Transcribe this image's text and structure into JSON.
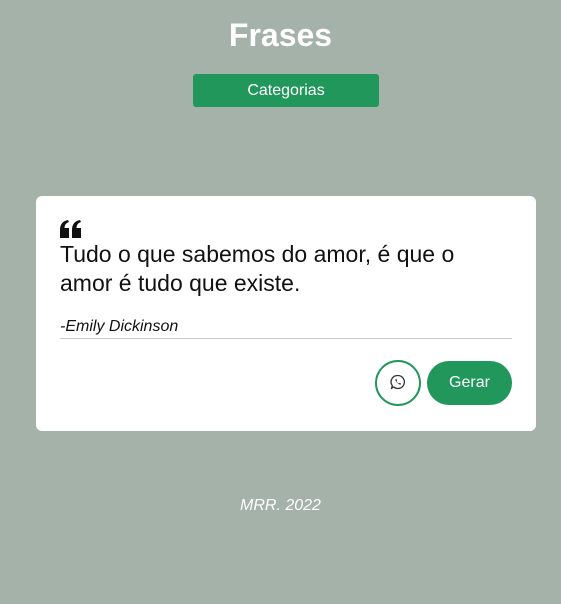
{
  "header": {
    "title": "Frases",
    "categories_label": "Categorias"
  },
  "quote": {
    "icon": "quote-left-icon",
    "text": "Tudo o que sabemos do amor, é que o amor é tudo que existe.",
    "author": "-Emily Dickinson"
  },
  "actions": {
    "share_icon": "whatsapp-icon",
    "generate_label": "Gerar"
  },
  "footer": {
    "credit": "MRR. 2022"
  },
  "colors": {
    "background": "#a4b2aa",
    "accent": "#22975c",
    "card": "#ffffff"
  }
}
